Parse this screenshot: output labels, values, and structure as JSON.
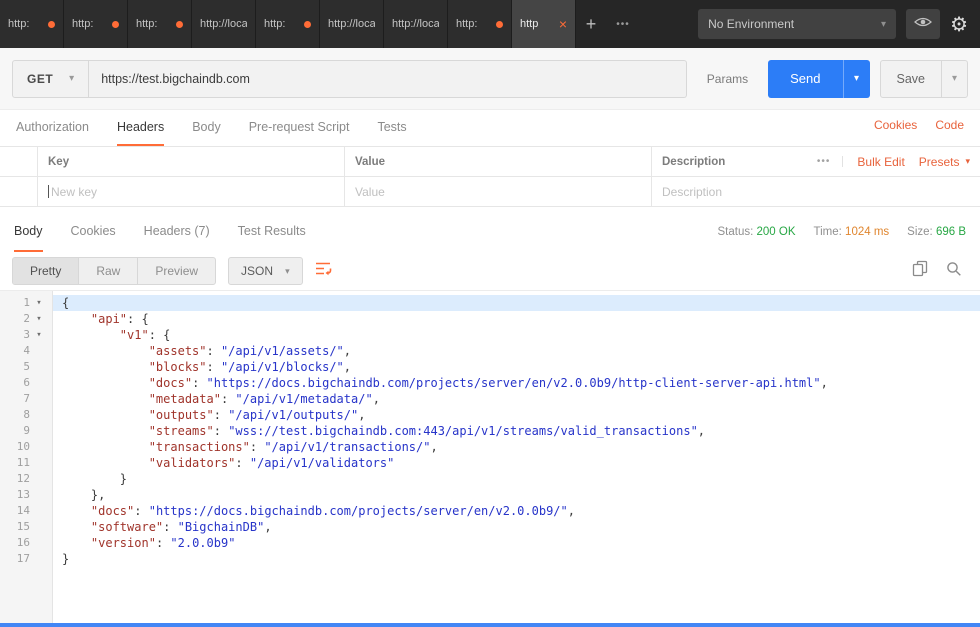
{
  "topbar": {
    "tabs": [
      {
        "label": "http:",
        "dot": true
      },
      {
        "label": "http:",
        "dot": true
      },
      {
        "label": "http:",
        "dot": true
      },
      {
        "label": "http://loca",
        "dot": false
      },
      {
        "label": "http:",
        "dot": true
      },
      {
        "label": "http://loca",
        "dot": false
      },
      {
        "label": "http://loca",
        "dot": false
      },
      {
        "label": "http:",
        "dot": true
      },
      {
        "label": "http",
        "dot": false,
        "active": true,
        "close": true
      }
    ],
    "new_tab_label": "+",
    "more_tabs_label": "•••",
    "environment": {
      "selected": "No Environment"
    }
  },
  "request": {
    "method": "GET",
    "url": "https://test.bigchaindb.com",
    "params_label": "Params",
    "send_label": "Send",
    "save_label": "Save",
    "tabs": [
      {
        "label": "Authorization",
        "active": false
      },
      {
        "label": "Headers",
        "active": true
      },
      {
        "label": "Body",
        "active": false
      },
      {
        "label": "Pre-request Script",
        "active": false
      },
      {
        "label": "Tests",
        "active": false
      }
    ],
    "cookies_label": "Cookies",
    "code_label": "Code",
    "headers_table": {
      "columns": [
        "Key",
        "Value",
        "Description"
      ],
      "more_label": "•••",
      "bulk_edit_label": "Bulk Edit",
      "presets_label": "Presets",
      "placeholders": {
        "key": "New key",
        "value": "Value",
        "description": "Description"
      }
    }
  },
  "response": {
    "tabs": [
      {
        "label": "Body",
        "active": true
      },
      {
        "label": "Cookies",
        "active": false
      },
      {
        "label": "Headers (7)",
        "active": false
      },
      {
        "label": "Test Results",
        "active": false
      }
    ],
    "meta": {
      "status_label": "Status:",
      "status_value": "200 OK",
      "time_label": "Time:",
      "time_value": "1024 ms",
      "size_label": "Size:",
      "size_value": "696 B"
    },
    "view_modes": [
      {
        "label": "Pretty",
        "active": true
      },
      {
        "label": "Raw",
        "active": false
      },
      {
        "label": "Preview",
        "active": false
      }
    ],
    "format": "JSON",
    "editor": {
      "language": "json",
      "lines": [
        {
          "n": 1,
          "fold": true,
          "active": true,
          "t": [
            [
              "p",
              "{"
            ]
          ]
        },
        {
          "n": 2,
          "fold": true,
          "t": [
            [
              "p",
              "    "
            ],
            [
              "k",
              "\"api\""
            ],
            [
              "p",
              ": {"
            ]
          ]
        },
        {
          "n": 3,
          "fold": true,
          "t": [
            [
              "p",
              "        "
            ],
            [
              "k",
              "\"v1\""
            ],
            [
              "p",
              ": {"
            ]
          ]
        },
        {
          "n": 4,
          "t": [
            [
              "p",
              "            "
            ],
            [
              "k",
              "\"assets\""
            ],
            [
              "p",
              ": "
            ],
            [
              "s",
              "\"/api/v1/assets/\""
            ],
            [
              "p",
              ","
            ]
          ]
        },
        {
          "n": 5,
          "t": [
            [
              "p",
              "            "
            ],
            [
              "k",
              "\"blocks\""
            ],
            [
              "p",
              ": "
            ],
            [
              "s",
              "\"/api/v1/blocks/\""
            ],
            [
              "p",
              ","
            ]
          ]
        },
        {
          "n": 6,
          "t": [
            [
              "p",
              "            "
            ],
            [
              "k",
              "\"docs\""
            ],
            [
              "p",
              ": "
            ],
            [
              "s",
              "\"https://docs.bigchaindb.com/projects/server/en/v2.0.0b9/http-client-server-api.html\""
            ],
            [
              "p",
              ","
            ]
          ]
        },
        {
          "n": 7,
          "t": [
            [
              "p",
              "            "
            ],
            [
              "k",
              "\"metadata\""
            ],
            [
              "p",
              ": "
            ],
            [
              "s",
              "\"/api/v1/metadata/\""
            ],
            [
              "p",
              ","
            ]
          ]
        },
        {
          "n": 8,
          "t": [
            [
              "p",
              "            "
            ],
            [
              "k",
              "\"outputs\""
            ],
            [
              "p",
              ": "
            ],
            [
              "s",
              "\"/api/v1/outputs/\""
            ],
            [
              "p",
              ","
            ]
          ]
        },
        {
          "n": 9,
          "t": [
            [
              "p",
              "            "
            ],
            [
              "k",
              "\"streams\""
            ],
            [
              "p",
              ": "
            ],
            [
              "s",
              "\"wss://test.bigchaindb.com:443/api/v1/streams/valid_transactions\""
            ],
            [
              "p",
              ","
            ]
          ]
        },
        {
          "n": 10,
          "t": [
            [
              "p",
              "            "
            ],
            [
              "k",
              "\"transactions\""
            ],
            [
              "p",
              ": "
            ],
            [
              "s",
              "\"/api/v1/transactions/\""
            ],
            [
              "p",
              ","
            ]
          ]
        },
        {
          "n": 11,
          "t": [
            [
              "p",
              "            "
            ],
            [
              "k",
              "\"validators\""
            ],
            [
              "p",
              ": "
            ],
            [
              "s",
              "\"/api/v1/validators\""
            ]
          ]
        },
        {
          "n": 12,
          "t": [
            [
              "p",
              "        }"
            ]
          ]
        },
        {
          "n": 13,
          "t": [
            [
              "p",
              "    },"
            ]
          ]
        },
        {
          "n": 14,
          "t": [
            [
              "p",
              "    "
            ],
            [
              "k",
              "\"docs\""
            ],
            [
              "p",
              ": "
            ],
            [
              "s",
              "\"https://docs.bigchaindb.com/projects/server/en/v2.0.0b9/\""
            ],
            [
              "p",
              ","
            ]
          ]
        },
        {
          "n": 15,
          "t": [
            [
              "p",
              "    "
            ],
            [
              "k",
              "\"software\""
            ],
            [
              "p",
              ": "
            ],
            [
              "s",
              "\"BigchainDB\""
            ],
            [
              "p",
              ","
            ]
          ]
        },
        {
          "n": 16,
          "t": [
            [
              "p",
              "    "
            ],
            [
              "k",
              "\"version\""
            ],
            [
              "p",
              ": "
            ],
            [
              "s",
              "\"2.0.0b9\""
            ]
          ]
        },
        {
          "n": 17,
          "t": [
            [
              "p",
              "}"
            ]
          ]
        }
      ]
    }
  },
  "colors": {
    "accent_orange": "#ff6c37",
    "send_blue": "#2c7df7",
    "status_green": "#28a745",
    "time_orange": "#e0862f",
    "json_key": "#a0342b",
    "json_string": "#2734c9",
    "active_line": "#dcecfd"
  }
}
